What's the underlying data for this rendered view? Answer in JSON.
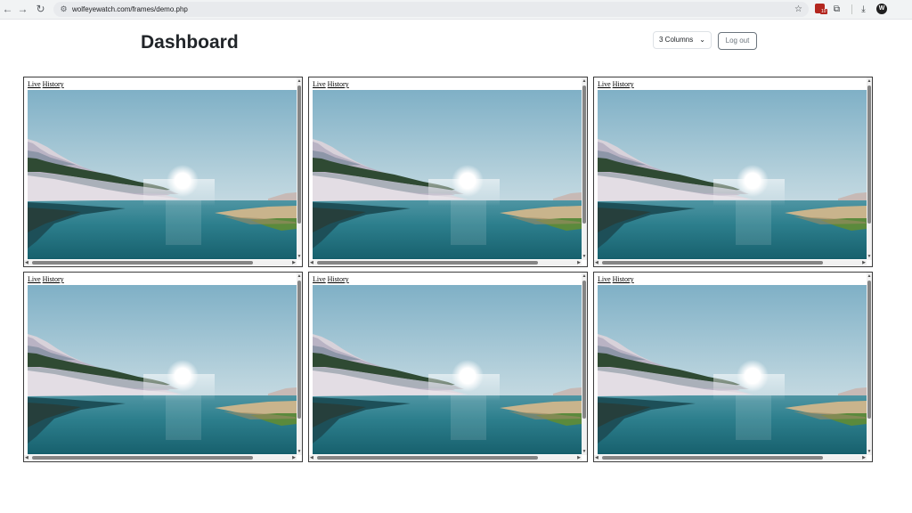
{
  "browser": {
    "url": "wolfeyewatch.com/frames/demo.php",
    "back_icon": "arrow-left-icon",
    "forward_icon": "arrow-right-icon",
    "reload_icon": "reload-icon",
    "bookmark_icon": "star-icon",
    "extension_badge_count": "10",
    "profile_initial": "W"
  },
  "header": {
    "title": "Dashboard",
    "columns_select": {
      "selected": "3 Columns"
    },
    "logout_label": "Log out"
  },
  "frames": [
    {
      "live_label": "Live",
      "history_label": "History"
    },
    {
      "live_label": "Live",
      "history_label": "History"
    },
    {
      "live_label": "Live",
      "history_label": "History"
    },
    {
      "live_label": "Live",
      "history_label": "History"
    },
    {
      "live_label": "Live",
      "history_label": "History"
    },
    {
      "live_label": "Live",
      "history_label": "History"
    }
  ],
  "colors": {
    "sky_top": "#7fb0c6",
    "sky_bottom": "#dfe7ea",
    "water": "#1f6f7c",
    "sun": "#ffffff"
  }
}
